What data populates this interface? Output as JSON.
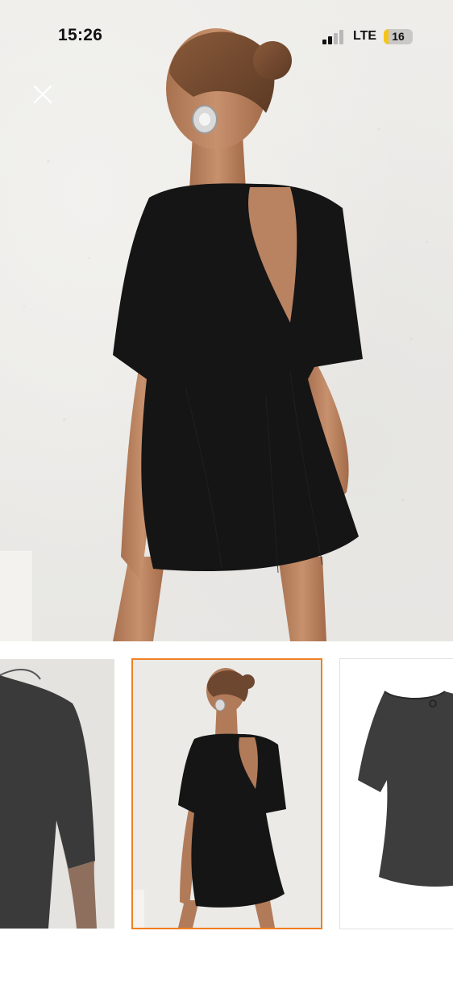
{
  "status_bar": {
    "time": "15:26",
    "network": "LTE",
    "battery": "16",
    "battery_fraction": 0.16,
    "signal_bars_active": 2,
    "signal_bars_total": 4
  },
  "viewer": {
    "close_icon": "close-icon",
    "selected_thumbnail": 2,
    "accent_color": "#f07f22"
  },
  "thumbnails": [
    {
      "name": "shoulder-closeup"
    },
    {
      "name": "back-view"
    },
    {
      "name": "product-flatlay"
    }
  ],
  "colors": {
    "garment": "#141414",
    "wall": "#ecebe8",
    "skin": "#c48d6b"
  }
}
